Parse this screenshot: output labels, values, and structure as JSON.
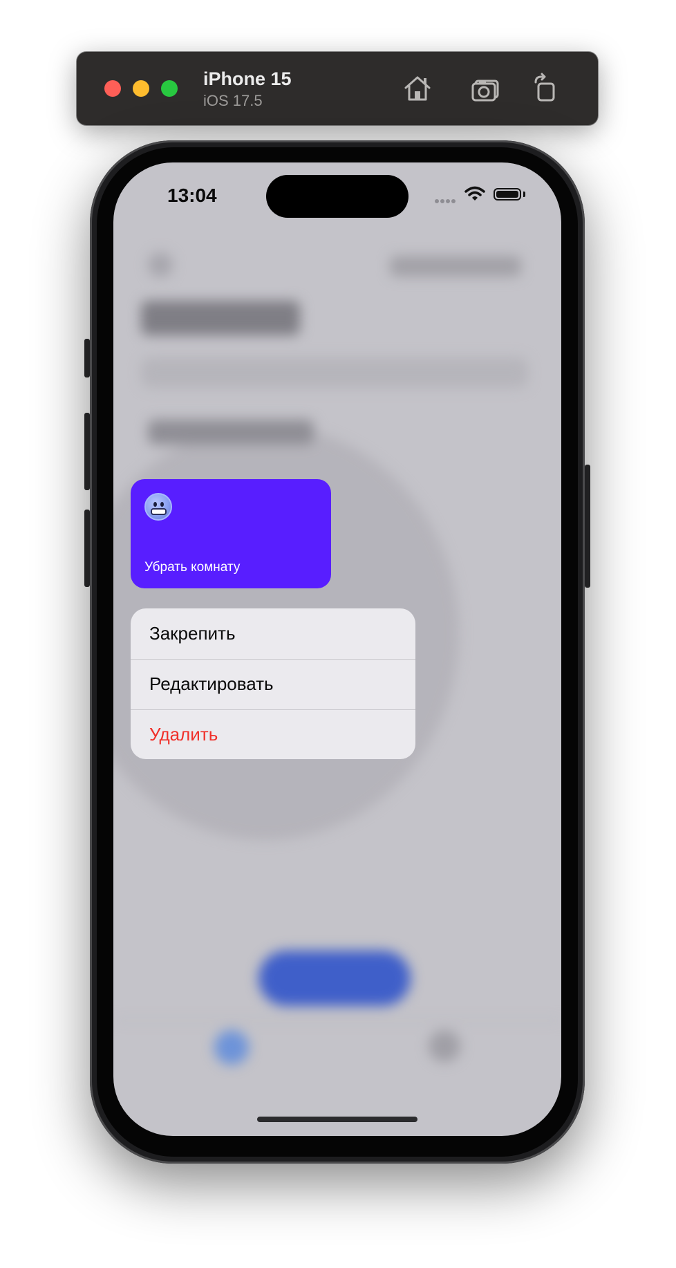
{
  "simulator": {
    "device_name": "iPhone 15",
    "os_version": "iOS 17.5",
    "buttons": {
      "home": "home-icon",
      "screenshot": "camera-icon",
      "rotate": "rotate-icon"
    }
  },
  "status_bar": {
    "time": "13:04"
  },
  "card": {
    "emoji": "cold-face-emoji",
    "title": "Убрать комнату",
    "color": "#581eff"
  },
  "context_menu": {
    "items": [
      {
        "label": "Закрепить"
      },
      {
        "label": "Редактировать"
      },
      {
        "label": "Удалить",
        "destructive": true,
        "color": "#f0302a"
      }
    ]
  }
}
